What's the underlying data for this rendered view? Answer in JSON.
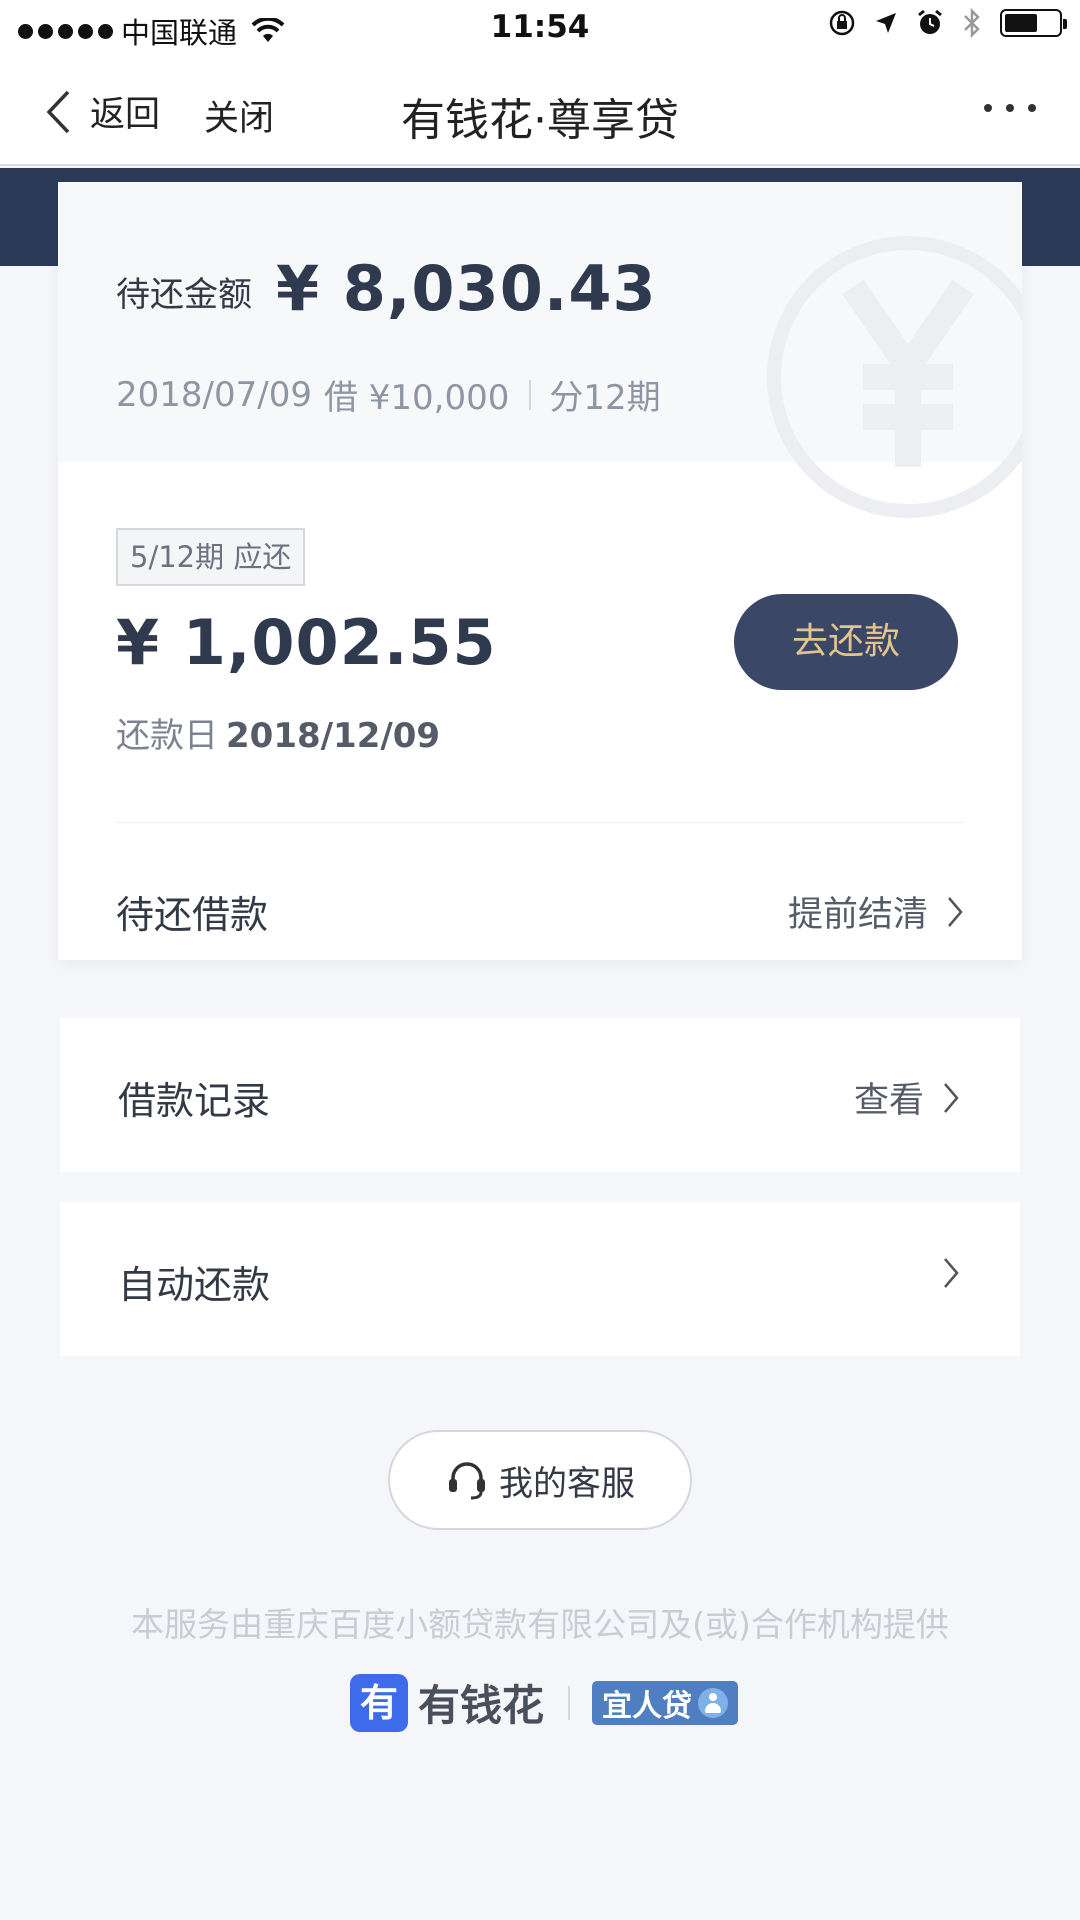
{
  "status_bar": {
    "carrier": "中国联通",
    "time": "11:54"
  },
  "nav": {
    "back_label": "返回",
    "close_label": "关闭",
    "title": "有钱花·尊享贷"
  },
  "summary": {
    "due_label": "待还金额",
    "due_amount": "¥ 8,030.43",
    "loan_date": "2018/07/09",
    "loan_text": "借 ¥10,000",
    "installments": "分12期"
  },
  "current_period": {
    "tag": "5/12期 应还",
    "amount": "¥ 1,002.55",
    "date_label": "还款日",
    "date": "2018/12/09",
    "repay_button": "去还款"
  },
  "pending_row": {
    "label": "待还借款",
    "action": "提前结清"
  },
  "records_row": {
    "label": "借款记录",
    "action": "查看"
  },
  "autopay_row": {
    "label": "自动还款"
  },
  "service_button": "我的客服",
  "footer_note": "本服务由重庆百度小额贷款有限公司及(或)合作机构提供",
  "brand": {
    "logo_char": "有",
    "name": "有钱花",
    "partner": "宜人贷"
  },
  "colors": {
    "navy": "#2b3a57",
    "button_bg": "#3b4766",
    "button_text": "#e3c48d",
    "brand_blue": "#3e6be9"
  },
  "battery_level": 0.62
}
